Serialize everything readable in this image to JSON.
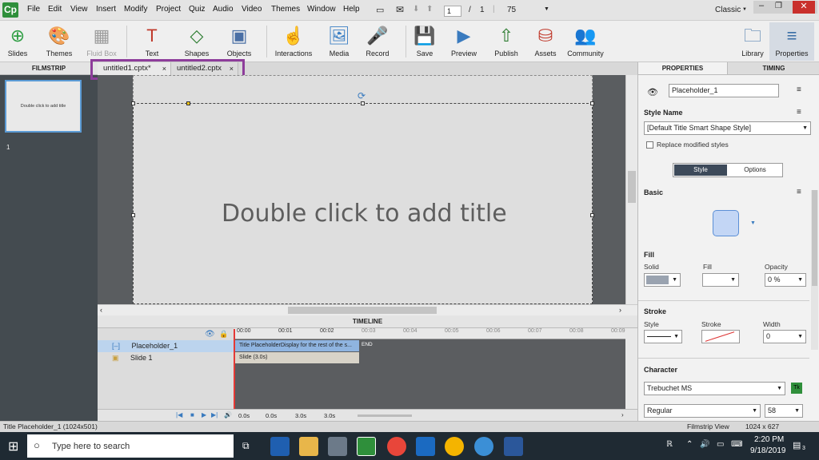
{
  "menubar": {
    "logo": "Cp",
    "items": [
      "File",
      "Edit",
      "View",
      "Insert",
      "Modify",
      "Project",
      "Quiz",
      "Audio",
      "Video",
      "Themes",
      "Window",
      "Help"
    ],
    "page_current": "1",
    "page_sep": "/",
    "page_total": "1",
    "zoom": "75",
    "workspace": "Classic"
  },
  "toolbar": {
    "buttons": [
      "Slides",
      "Themes",
      "Fluid Box",
      "Text",
      "Shapes",
      "Objects",
      "Interactions",
      "Media",
      "Record",
      "Save",
      "Preview",
      "Publish",
      "Assets",
      "Community",
      "Library",
      "Properties"
    ]
  },
  "filmstrip": {
    "header": "FILMSTRIP",
    "thumb_text": "Double click to add title",
    "slide_number": "1"
  },
  "tabs": [
    {
      "label": "untitled1.cptx*",
      "close": "×"
    },
    {
      "label": "untitled2.cptx",
      "close": "×"
    }
  ],
  "stage": {
    "title_placeholder": "Double click to add title"
  },
  "timeline": {
    "header": "TIMELINE",
    "rows": [
      {
        "label": "Placeholder_1",
        "bar": "Title PlaceholderDisplay for the rest of the s..."
      },
      {
        "label": "Slide 1",
        "bar": "Slide (3.0s)"
      }
    ],
    "end_label": "END",
    "ticks": [
      "00:00",
      "00:01",
      "00:02",
      "00:03",
      "00:04",
      "00:05",
      "00:06",
      "00:07",
      "00:08",
      "00:09"
    ],
    "controls": {
      "t1": "0.0s",
      "t2": "0.0s",
      "t3": "3.0s",
      "t4": "3.0s"
    }
  },
  "status": {
    "left": "Title Placeholder_1 (1024x501)",
    "view": "Filmstrip View",
    "size": "1024 x 627"
  },
  "properties": {
    "tabs": [
      "PROPERTIES",
      "TIMING"
    ],
    "name": "Placeholder_1",
    "style_name_label": "Style Name",
    "style_name": "[Default Title Smart Shape Style]",
    "replace_label": "Replace modified styles",
    "sub_tabs": [
      "Style",
      "Options"
    ],
    "basic_label": "Basic",
    "fill_label": "Fill",
    "fill_solid": "Solid",
    "fill_fill": "Fill",
    "fill_opacity_label": "Opacity",
    "fill_opacity": "0 %",
    "stroke_label": "Stroke",
    "stroke_style": "Style",
    "stroke_stroke": "Stroke",
    "stroke_width_label": "Width",
    "stroke_width": "0",
    "character_label": "Character",
    "font": "Trebuchet MS",
    "font_style": "Regular",
    "font_size": "58",
    "tk": "Tk"
  },
  "taskbar": {
    "search": "Type here to search",
    "time": "2:20 PM",
    "date": "9/18/2019",
    "notifications": "3"
  },
  "colors": {
    "accent": "#2f8f3b",
    "highlight": "#8e3d9b",
    "selection": "#5b9bd5"
  }
}
